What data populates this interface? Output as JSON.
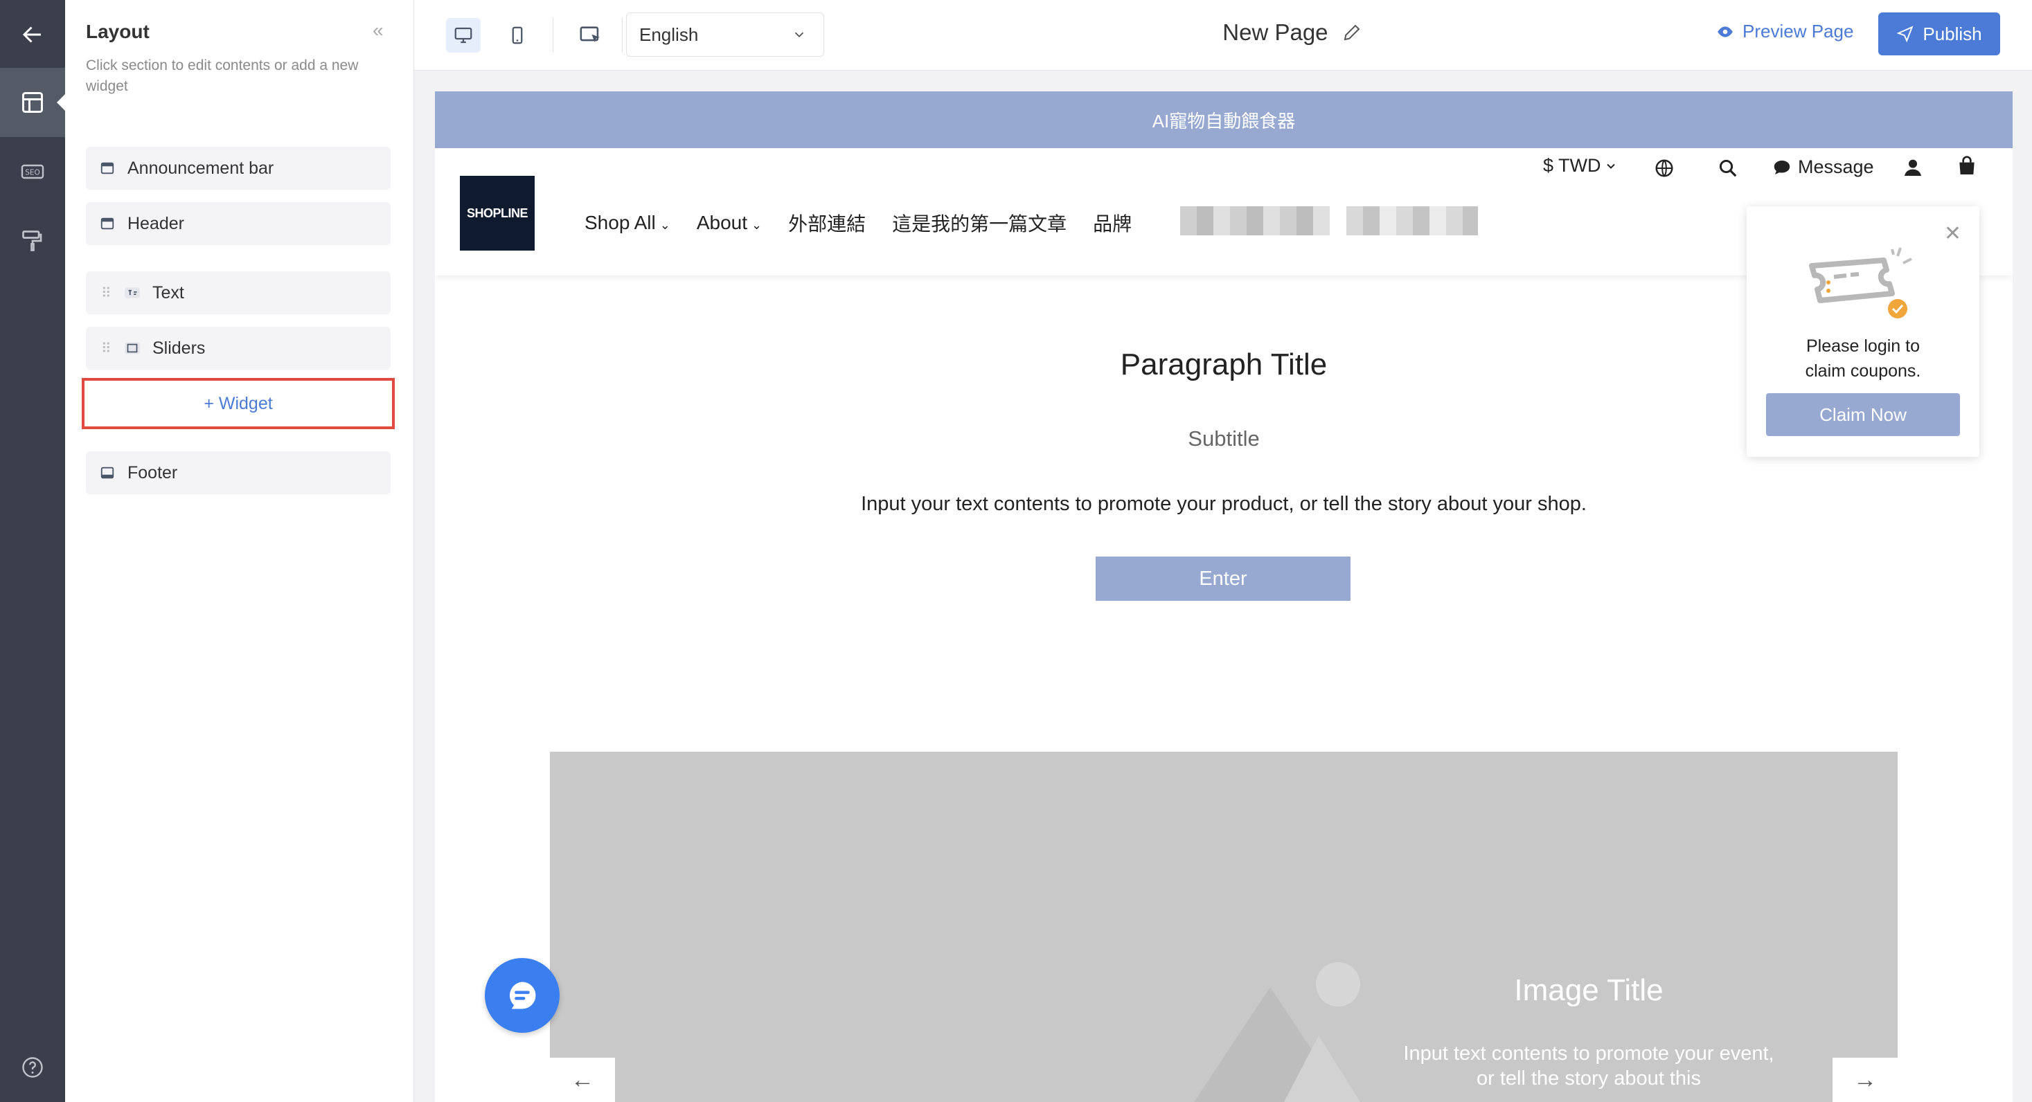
{
  "rail": {
    "icons": [
      "back-arrow-icon",
      "layout-icon",
      "seo-icon",
      "paint-roller-icon",
      "help-icon"
    ]
  },
  "panel": {
    "title": "Layout",
    "collapse_glyph": "«",
    "description": "Click section to edit contents or add a new widget",
    "sections": [
      {
        "label": "Announcement bar"
      },
      {
        "label": "Header"
      },
      {
        "label": "Text"
      },
      {
        "label": "Sliders"
      },
      {
        "label": "Footer"
      }
    ],
    "add_widget_label": "+ Widget"
  },
  "toolbar": {
    "language": "English",
    "page_title": "New Page",
    "preview_label": "Preview Page",
    "publish_label": "Publish"
  },
  "site": {
    "announcement": "AI寵物自動餵食器",
    "logo_text": "SHOPLINE",
    "nav": [
      "Shop All",
      "About",
      "外部連結",
      "這是我的第一篇文章",
      "品牌"
    ],
    "currency": "$ TWD",
    "message_label": "Message",
    "coupon_popup": {
      "text_line1": "Please login to",
      "text_line2": "claim coupons.",
      "button": "Claim Now",
      "close_glyph": "✕"
    },
    "paragraph": {
      "title": "Paragraph Title",
      "subtitle": "Subtitle",
      "body": "Input your text contents to promote your product, or tell the story about your shop.",
      "button": "Enter"
    },
    "slider": {
      "title": "Image Title",
      "body": "Input text contents to promote your event, or tell the story about this",
      "prev_glyph": "←",
      "next_glyph": "→"
    }
  },
  "colors": {
    "rail": "#3a3f4b",
    "accent": "#4b7bd6",
    "site_accent": "#97a8d1",
    "highlight_border": "#e04a3f",
    "chat_fab": "#3a7ef0"
  }
}
